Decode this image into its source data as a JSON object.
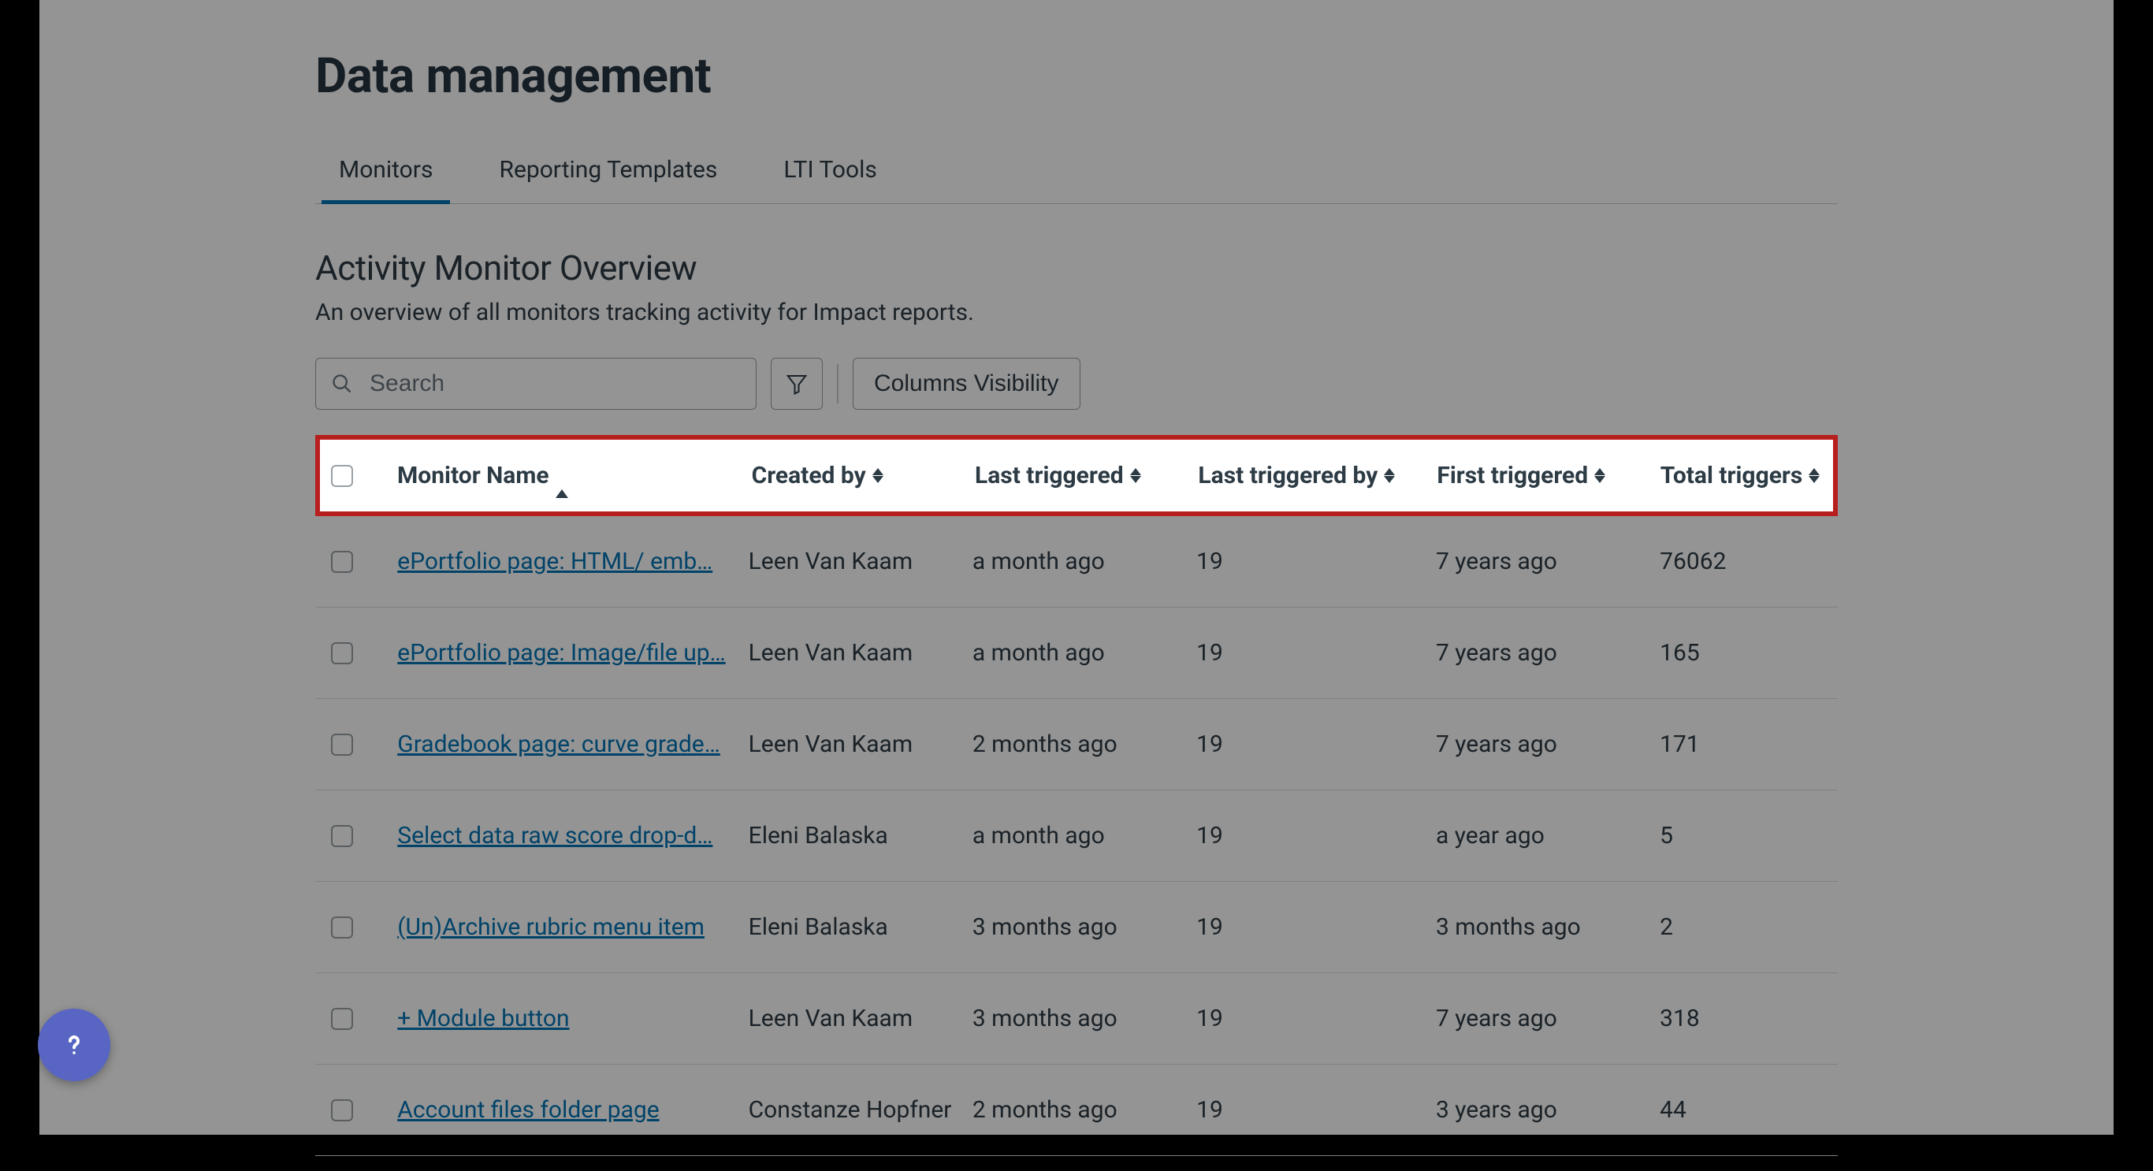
{
  "page": {
    "title": "Data management"
  },
  "tabs": [
    {
      "label": "Monitors",
      "active": true
    },
    {
      "label": "Reporting Templates",
      "active": false
    },
    {
      "label": "LTI Tools",
      "active": false
    }
  ],
  "section": {
    "title": "Activity Monitor Overview",
    "description": "An overview of all monitors tracking activity for Impact reports."
  },
  "search": {
    "placeholder": "Search",
    "value": ""
  },
  "buttons": {
    "columns_visibility": "Columns Visibility"
  },
  "table": {
    "headers": {
      "monitor_name": "Monitor Name",
      "created_by": "Created by",
      "last_triggered": "Last triggered",
      "last_triggered_by": "Last triggered by",
      "first_triggered": "First triggered",
      "total_triggers": "Total triggers"
    },
    "rows": [
      {
        "name": "ePortfolio page: HTML/ emb…",
        "created_by": "Leen Van Kaam",
        "last_triggered": "a month ago",
        "last_triggered_by": "19",
        "first_triggered": "7 years ago",
        "total_triggers": "76062"
      },
      {
        "name": "ePortfolio page: Image/file up…",
        "created_by": "Leen Van Kaam",
        "last_triggered": "a month ago",
        "last_triggered_by": "19",
        "first_triggered": "7 years ago",
        "total_triggers": "165"
      },
      {
        "name": "Gradebook page: curve grade…",
        "created_by": "Leen Van Kaam",
        "last_triggered": "2 months ago",
        "last_triggered_by": "19",
        "first_triggered": "7 years ago",
        "total_triggers": "171"
      },
      {
        "name": "Select data raw score drop-d…",
        "created_by": "Eleni Balaska",
        "last_triggered": "a month ago",
        "last_triggered_by": "19",
        "first_triggered": "a year ago",
        "total_triggers": "5"
      },
      {
        "name": "(Un)Archive rubric menu item",
        "created_by": "Eleni Balaska",
        "last_triggered": "3 months ago",
        "last_triggered_by": "19",
        "first_triggered": "3 months ago",
        "total_triggers": "2"
      },
      {
        "name": "+ Module button",
        "created_by": "Leen Van Kaam",
        "last_triggered": "3 months ago",
        "last_triggered_by": "19",
        "first_triggered": "7 years ago",
        "total_triggers": "318"
      },
      {
        "name": "Account files folder page",
        "created_by": "Constanze Hopfner",
        "last_triggered": "2 months ago",
        "last_triggered_by": "19",
        "first_triggered": "3 years ago",
        "total_triggers": "44"
      }
    ]
  }
}
